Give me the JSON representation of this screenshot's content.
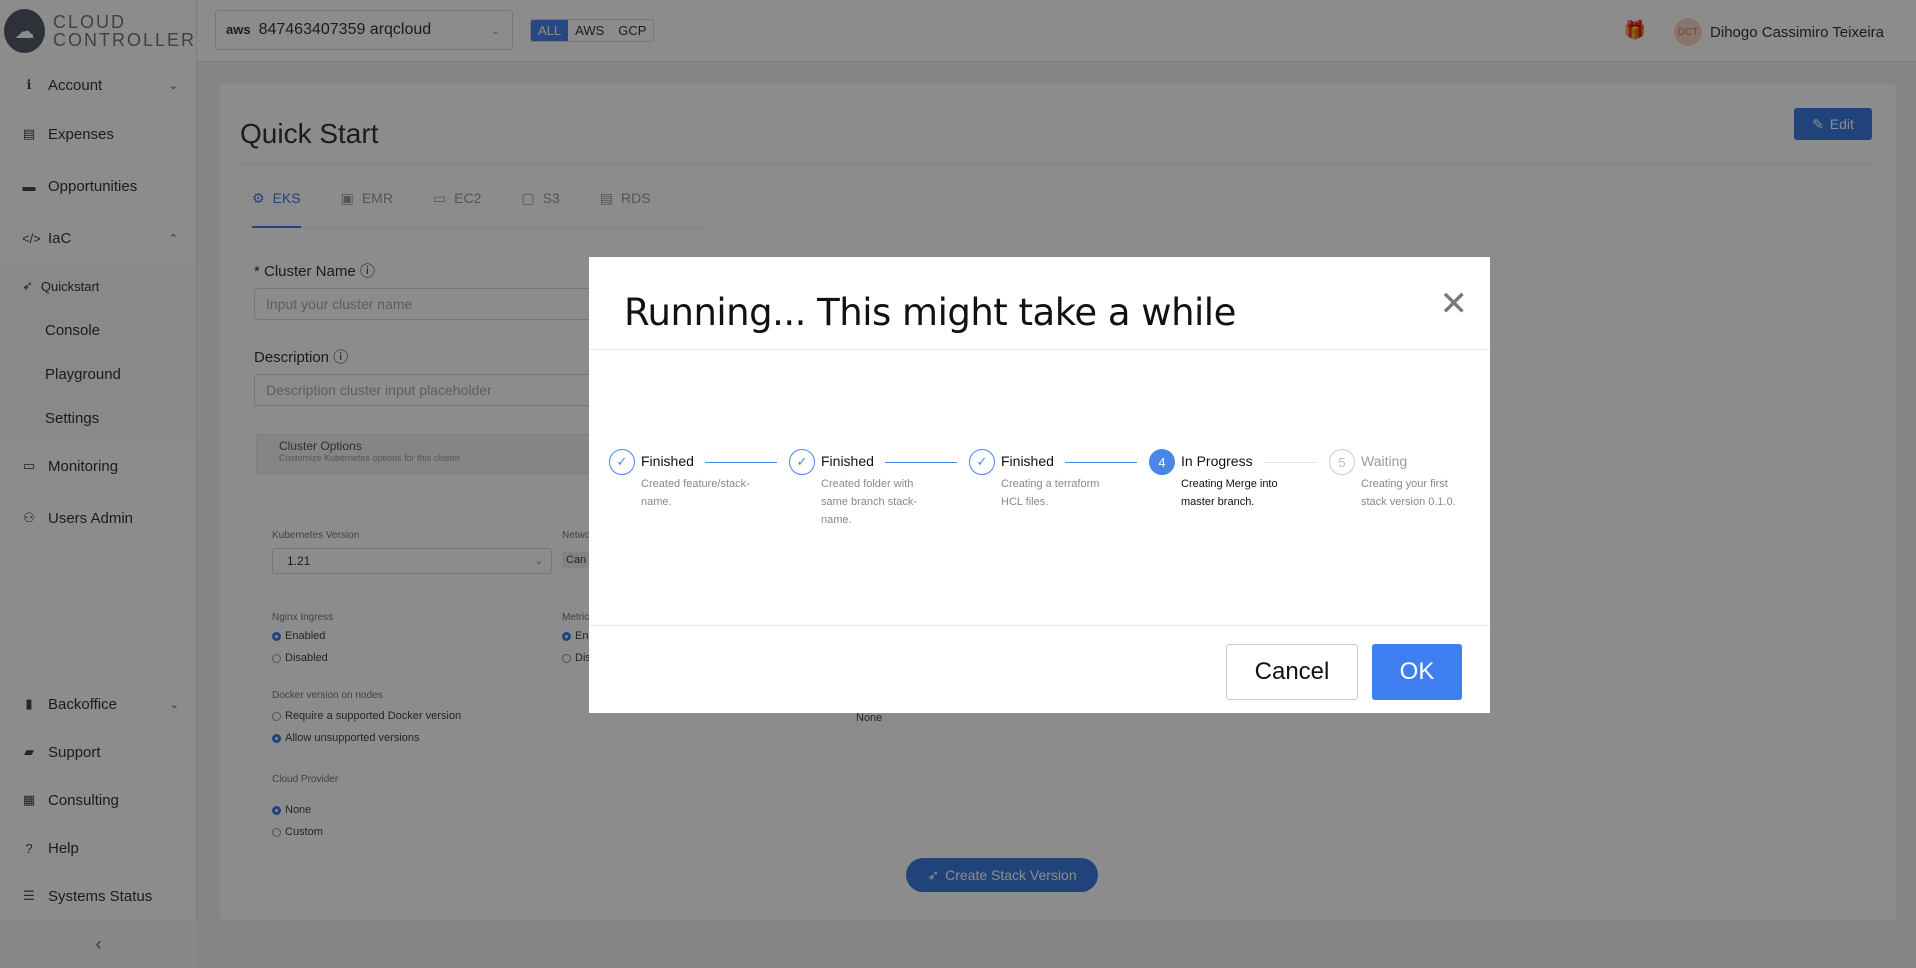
{
  "brand": {
    "line1": "CLOUD",
    "line2": "CONTROLLER"
  },
  "sidebar": {
    "items": [
      {
        "label": "Account",
        "icon": "info-icon"
      },
      {
        "label": "Expenses",
        "icon": "money-icon"
      },
      {
        "label": "Opportunities",
        "icon": "comment-icon"
      },
      {
        "label": "IaC",
        "icon": "code-icon"
      },
      {
        "label": "Monitoring",
        "icon": "monitor-icon"
      },
      {
        "label": "Users Admin",
        "icon": "users-icon"
      },
      {
        "label": "Backoffice",
        "icon": "building-icon"
      },
      {
        "label": "Support",
        "icon": "chat-icon"
      },
      {
        "label": "Consulting",
        "icon": "calendar-icon"
      },
      {
        "label": "Help",
        "icon": "question-icon"
      },
      {
        "label": "Systems Status",
        "icon": "list-icon"
      }
    ],
    "iac_sub": [
      "Quickstart",
      "Console",
      "Playground",
      "Settings"
    ]
  },
  "topbar": {
    "aws_logo": "aws",
    "account": "847463407359 arqcloud",
    "filters": [
      "ALL",
      "AWS",
      "GCP"
    ],
    "user_initials": "DCT",
    "user_name": "Dihogo Cassimiro Teixeira"
  },
  "page": {
    "title": "Quick Start",
    "edit": "Edit",
    "tabs": [
      "EKS",
      "EMR",
      "EC2",
      "S3",
      "RDS"
    ],
    "cluster_name_label": "* Cluster Name",
    "cluster_name_placeholder": "Input your cluster name",
    "description_label": "Description",
    "description_placeholder": "Description cluster input placeholder",
    "options_title": "Cluster Options",
    "options_sub": "Customize Kubernetes options for this cluster",
    "k8s_label": "Kubernetes Version",
    "k8s_value": "1.21",
    "network_label": "Netwo",
    "network_value": "Can",
    "nginx_label": "Nginx Ingress",
    "nginx_enabled": "Enabled",
    "nginx_disabled": "Disabled",
    "metrics_label": "Metric",
    "metrics_enabled": "En",
    "metrics_disabled": "Dis",
    "docker_label": "Docker version on nodes",
    "docker_opt1": "Require a supported Docker version",
    "docker_opt2": "Allow unsupported versions",
    "none_value": "None",
    "provider_label": "Cloud Provider",
    "provider_none": "None",
    "provider_custom": "Custom",
    "create_button": "Create Stack Version"
  },
  "modal": {
    "title": "Running... This might take a while",
    "steps": [
      {
        "status": "Finished",
        "desc": "Created feature/stack-name.",
        "state": "done",
        "num": ""
      },
      {
        "status": "Finished",
        "desc": "Created folder with same branch stack-name.",
        "state": "done",
        "num": ""
      },
      {
        "status": "Finished",
        "desc": "Creating a terraform HCL files.",
        "state": "done",
        "num": ""
      },
      {
        "status": "In Progress",
        "desc": "Creating Merge into master branch.",
        "state": "active",
        "num": "4"
      },
      {
        "status": "Waiting",
        "desc": "Creating your first stack version 0.1.0.",
        "state": "wait",
        "num": "5"
      }
    ],
    "cancel": "Cancel",
    "ok": "OK"
  }
}
